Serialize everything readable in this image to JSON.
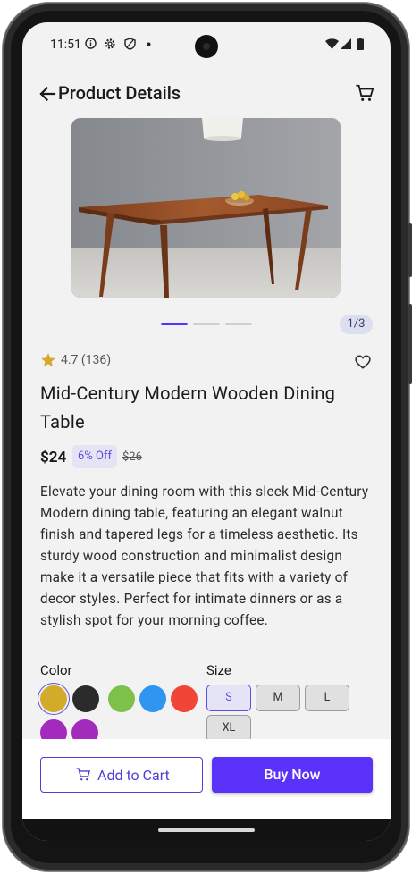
{
  "status_bar": {
    "time": "11:51"
  },
  "app_bar": {
    "title": "Product Details"
  },
  "gallery": {
    "page_indicator": "1/3",
    "current_index": 1,
    "total": 3
  },
  "product": {
    "rating": "4.7 (136)",
    "name": "Mid-Century Modern Wooden Dining Table",
    "price": "$24",
    "discount": "6% Off",
    "original_price": "$26",
    "description": "Elevate your dining room with this sleek Mid-Century Modern dining table, featuring an elegant walnut finish and tapered legs for a timeless aesthetic. Its sturdy wood construction and minimalist design make it a versatile piece that fits with a variety of decor styles. Perfect for intimate dinners or as a stylish spot for your morning coffee."
  },
  "options": {
    "color_label": "Color",
    "colors": [
      "#d4aa2a",
      "#2b2b2b",
      "#7dc04a",
      "#2e95f0",
      "#f14637",
      "#a22bbd",
      "#a22bbd"
    ],
    "selected_color": "#d4aa2a",
    "size_label": "Size",
    "sizes": [
      "S",
      "M",
      "L",
      "XL"
    ],
    "selected_size": "S"
  },
  "actions": {
    "add_to_cart": "Add to Cart",
    "buy_now": "Buy Now"
  },
  "theme": {
    "accent": "#5a32fa",
    "star": "#d6a72a"
  }
}
